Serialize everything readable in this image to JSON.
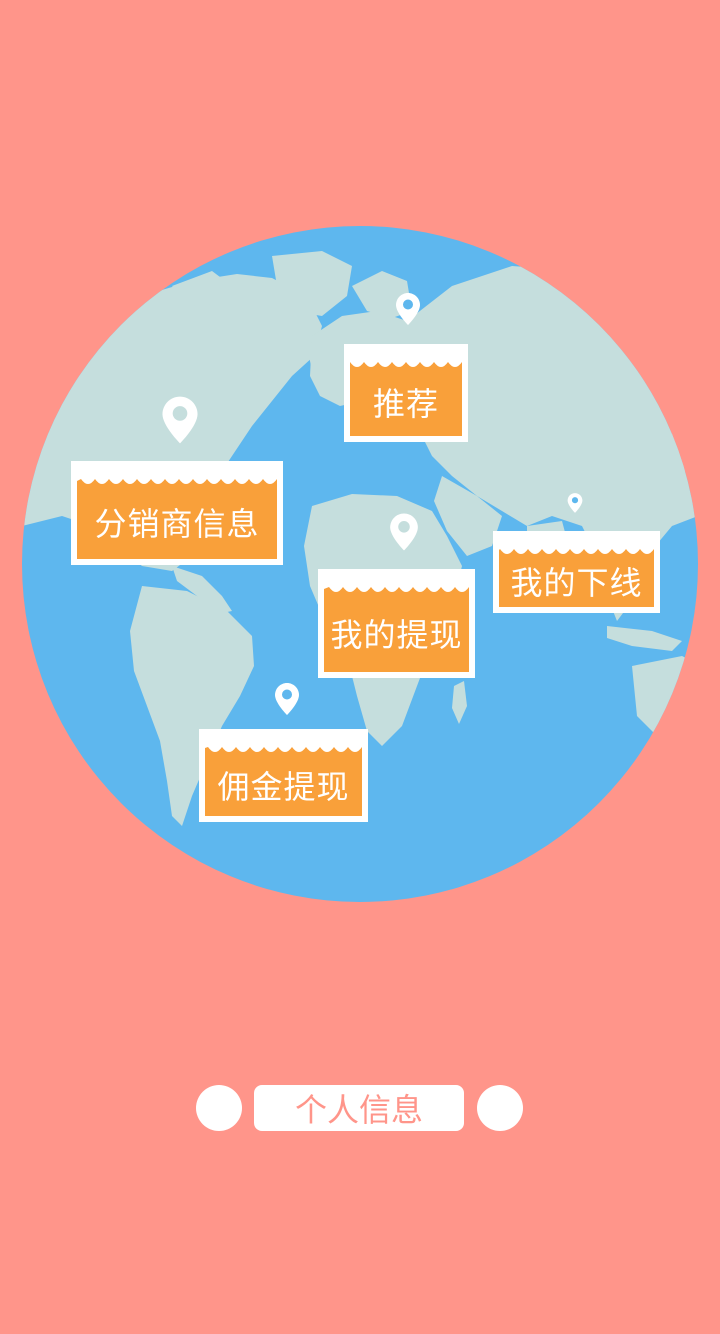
{
  "colors": {
    "background": "#FF958A",
    "ocean": "#5EB7EE",
    "land": "#C5DEDD",
    "sign": "#F9A03A",
    "white": "#FFFFFF"
  },
  "signs": {
    "recommend": "推荐",
    "distributor_info": "分销商信息",
    "my_downline": "我的下线",
    "my_withdraw": "我的提现",
    "commission_withdraw": "佣金提现"
  },
  "bottom_nav": {
    "label": "个人信息"
  }
}
